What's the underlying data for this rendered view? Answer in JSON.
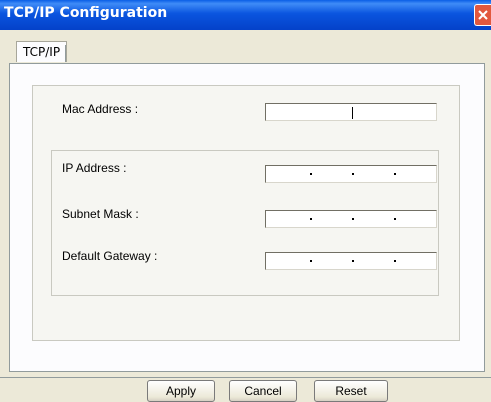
{
  "window": {
    "title": "TCP/IP Configuration"
  },
  "tabs": [
    {
      "label": "TCP/IP"
    }
  ],
  "form": {
    "mac_label": "Mac Address :",
    "ip_label": "IP Address :",
    "subnet_label": "Subnet Mask :",
    "gateway_label": "Default Gateway :"
  },
  "buttons": {
    "apply": "Apply",
    "cancel": "Cancel",
    "reset": "Reset"
  },
  "icons": {
    "close": "close-icon"
  },
  "colors": {
    "titlebar": "#0a55df",
    "close_button": "#e2583e",
    "dialog_bg": "#ece9d8"
  }
}
